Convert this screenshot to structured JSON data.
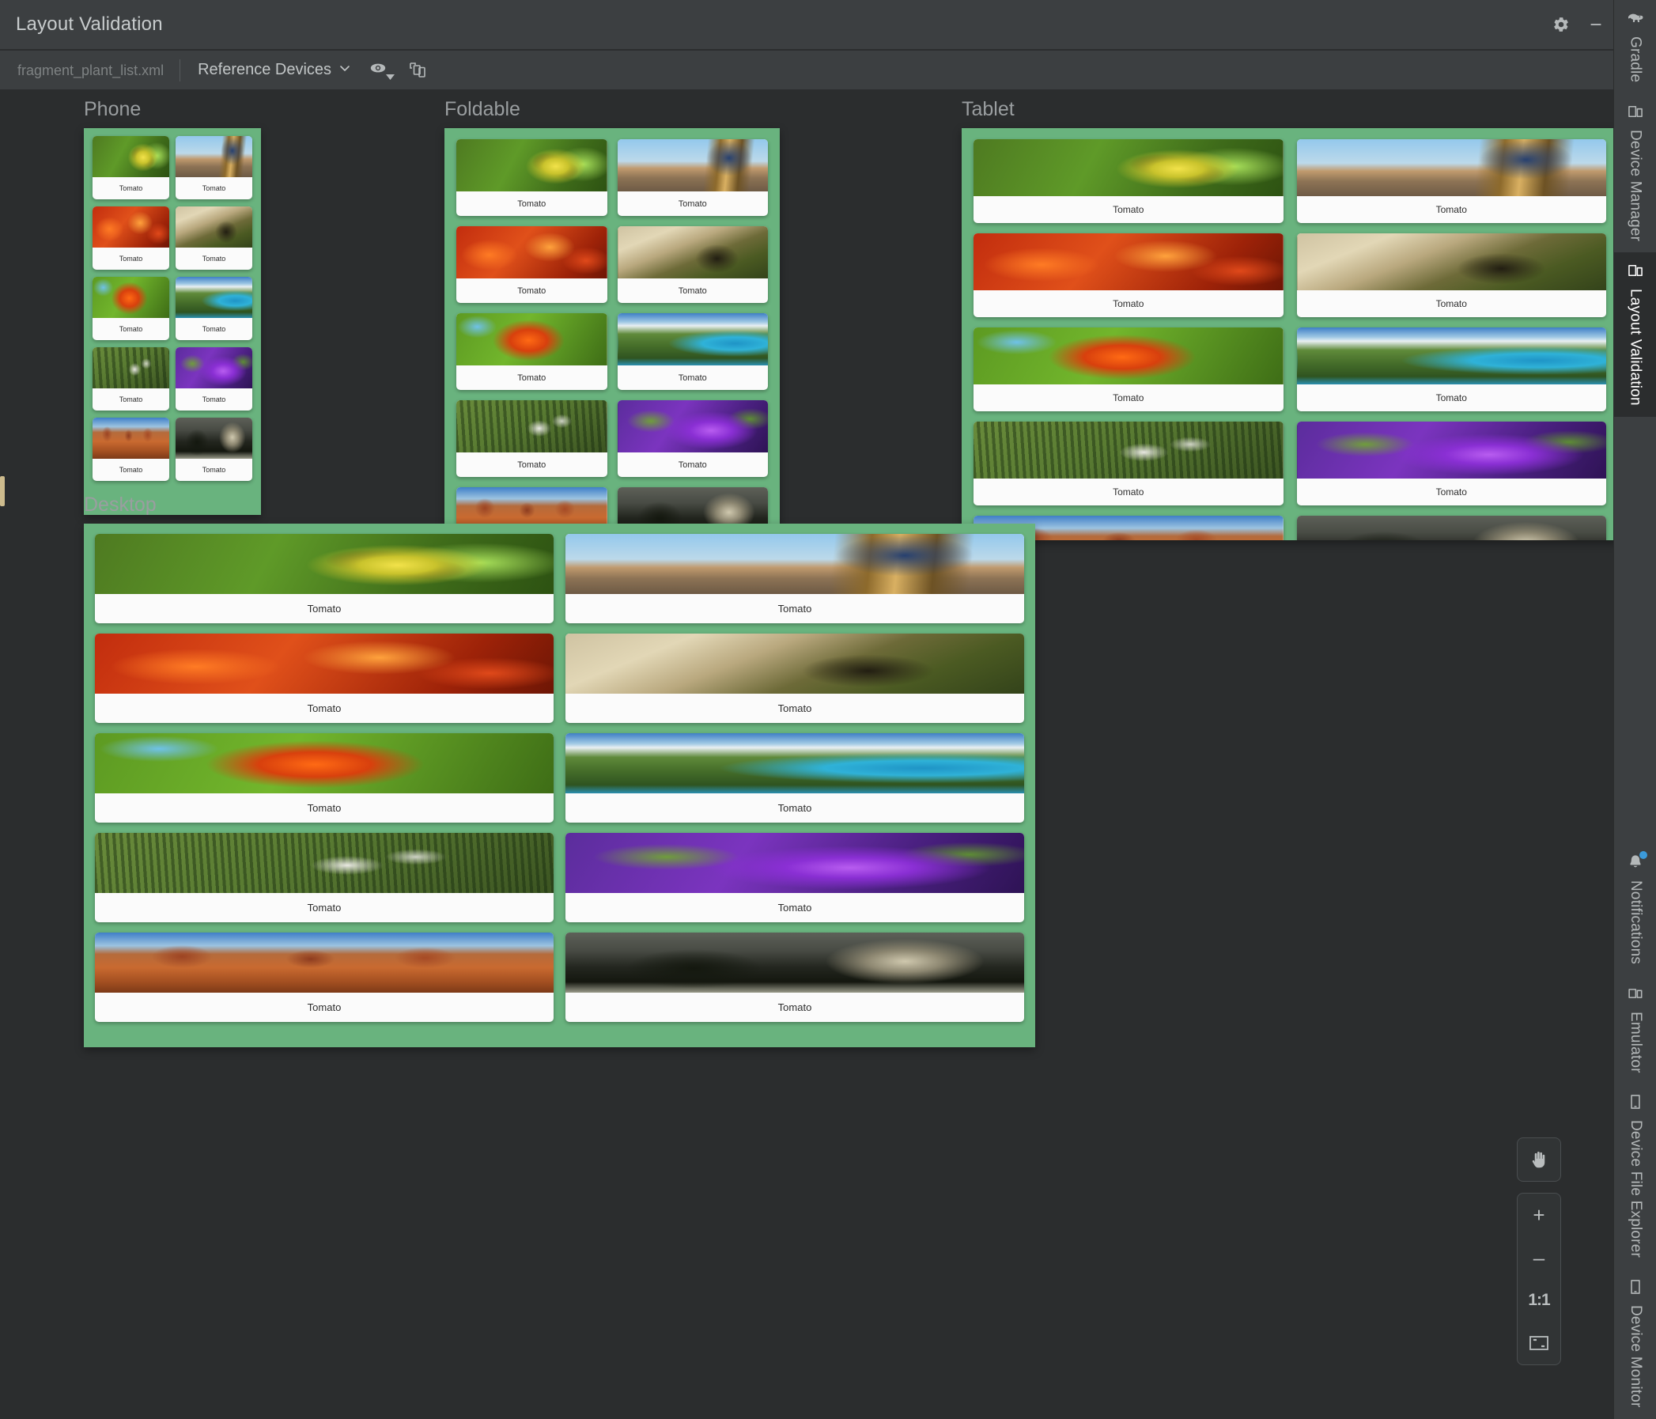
{
  "window": {
    "title": "Layout Validation",
    "settings_icon": "gear-icon",
    "minimize_icon": "minimize-icon"
  },
  "toolbar": {
    "file_name": "fragment_plant_list.xml",
    "mode_label": "Reference Devices",
    "mode_caret_icon": "chevron-down-icon",
    "visibility_icon": "eye-icon",
    "visibility_caret_icon": "caret-down-icon",
    "layers_icon": "copy-layers-icon"
  },
  "previews": [
    {
      "id": "phone",
      "label": "Phone",
      "columns": 2,
      "cards": 10,
      "card_label": "Tomato",
      "clipped": false
    },
    {
      "id": "foldable",
      "label": "Foldable",
      "columns": 2,
      "cards": 10,
      "card_label": "Tomato",
      "clipped": true
    },
    {
      "id": "tablet",
      "label": "Tablet",
      "columns": 2,
      "cards": 10,
      "card_label": "Tomato",
      "clipped": true
    },
    {
      "id": "desktop",
      "label": "Desktop",
      "columns": 2,
      "cards": 10,
      "card_label": "Tomato",
      "clipped": false
    }
  ],
  "card_label": "Tomato",
  "rail": {
    "top_items": [
      {
        "label": "Gradle",
        "icon": "gradle-elephant-icon",
        "active": false
      },
      {
        "label": "Device Manager",
        "icon": "device-manager-icon",
        "active": false
      },
      {
        "label": "Layout Validation",
        "icon": "layout-validation-icon",
        "active": true
      }
    ],
    "bottom_items": [
      {
        "label": "Notifications",
        "icon": "bell-icon",
        "active": false,
        "badge": true
      },
      {
        "label": "Emulator",
        "icon": "emulator-icon",
        "active": false,
        "badge": false
      },
      {
        "label": "Device File Explorer",
        "icon": "device-file-explorer-icon",
        "active": false,
        "badge": false
      },
      {
        "label": "Device Monitor",
        "icon": "device-monitor-icon",
        "active": false,
        "badge": false
      }
    ]
  },
  "zoom_controls": {
    "pan_label": "",
    "pan_icon": "hand-pan-icon",
    "zoom_in": "+",
    "zoom_out": "–",
    "actual_size": "1:1",
    "fit_icon": "fit-to-screen-icon"
  },
  "colors": {
    "panel_green": "#69b37e",
    "card_white": "#fbfbfb",
    "chrome": "#3c3f41",
    "canvas": "#2b2d2e",
    "badge_blue": "#3b9ada"
  }
}
